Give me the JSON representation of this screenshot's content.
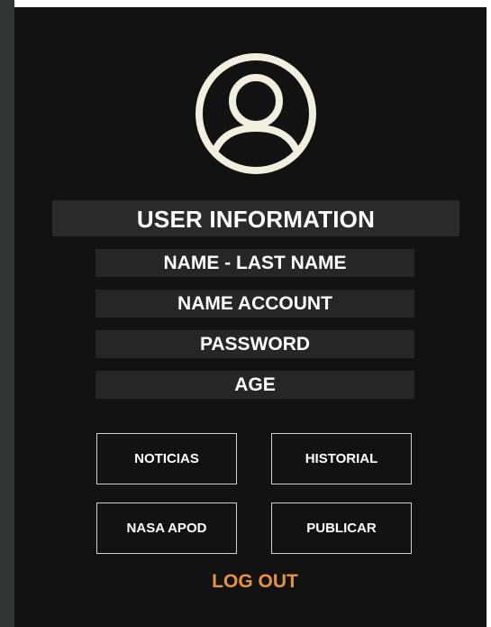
{
  "profile": {
    "avatar_icon": "user-circle-icon",
    "section_title": "USER INFORMATION",
    "fields": [
      "NAME - LAST NAME",
      "NAME ACCOUNT",
      "PASSWORD",
      "AGE"
    ]
  },
  "actions": {
    "noticias": "NOTICIAS",
    "historial": "HISTORIAL",
    "nasa_apod": "NASA APOD",
    "publicar": "PUBLICAR"
  },
  "logout": {
    "label": "LOG OUT",
    "color": "#e8923a"
  },
  "colors": {
    "background": "#121212",
    "icon": "#f3efdf",
    "field_background": "#262626"
  }
}
